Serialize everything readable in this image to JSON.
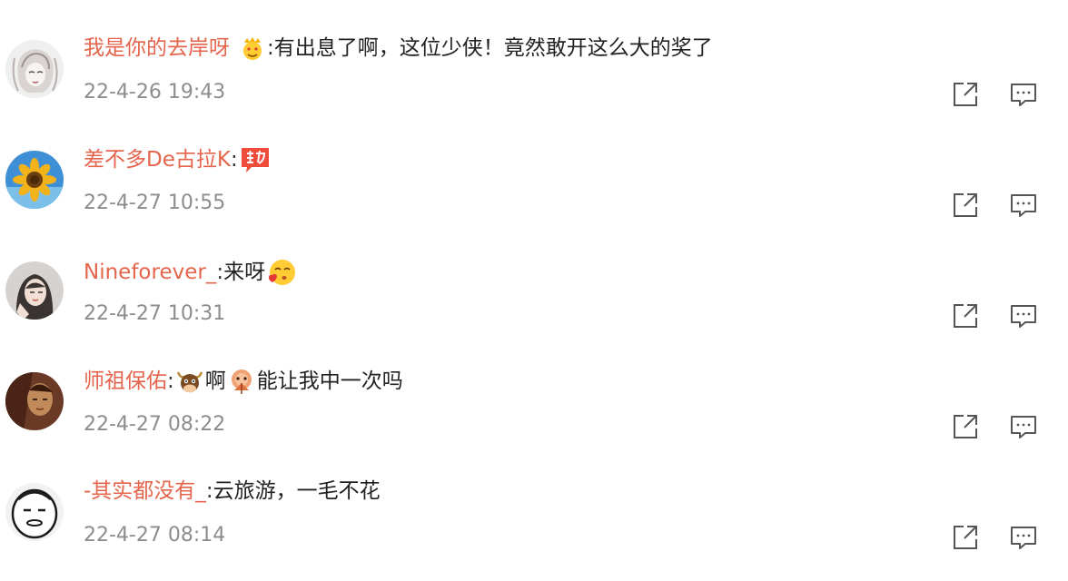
{
  "comments": [
    {
      "username": "我是你的去岸呀",
      "colon": ":",
      "text_before": "",
      "text": "有出息了啊，这位少侠！竟然敢开这么大的奖了",
      "emojis": [
        "crown-heart-eyes-emoji"
      ],
      "time": "22-4-26 19:43",
      "avatar_colors": [
        "#e9e9e9",
        "#c7c0be"
      ]
    },
    {
      "username": "差不多De古拉K",
      "colon": ":",
      "text_before": "",
      "text": "",
      "emojis": [
        "encourage-badge-emoji"
      ],
      "time": "22-4-27 10:55",
      "avatar_colors": [
        "#3e8fd6",
        "#f2b21a"
      ]
    },
    {
      "username": "Nineforever_",
      "colon": ":",
      "text_before": "",
      "text": "来呀",
      "emojis": [
        "blow-kiss-emoji"
      ],
      "time": "22-4-27 10:31",
      "avatar_colors": [
        "#d6d2cf",
        "#3a3532"
      ]
    },
    {
      "username": "师祖保佑",
      "colon": ":",
      "text_before": "啊",
      "text": "能让我中一次吗",
      "emojis": [
        "bull-emoji",
        "pray-emoji"
      ],
      "time": "22-4-27 08:22",
      "avatar_colors": [
        "#6b3a26",
        "#c08a5a"
      ]
    },
    {
      "username": "-其实都没有_",
      "colon": ":",
      "text_before": "",
      "text": "云旅游，一毛不花",
      "emojis": [],
      "time": "22-4-27 08:14",
      "avatar_colors": [
        "#f2f2f2",
        "#1b1b1b"
      ]
    }
  ],
  "colors": {
    "username": "#e4644c",
    "time": "#8d8d8d",
    "icon": "#555555"
  },
  "icons": {
    "share": "share-icon",
    "reply": "comment-icon"
  }
}
